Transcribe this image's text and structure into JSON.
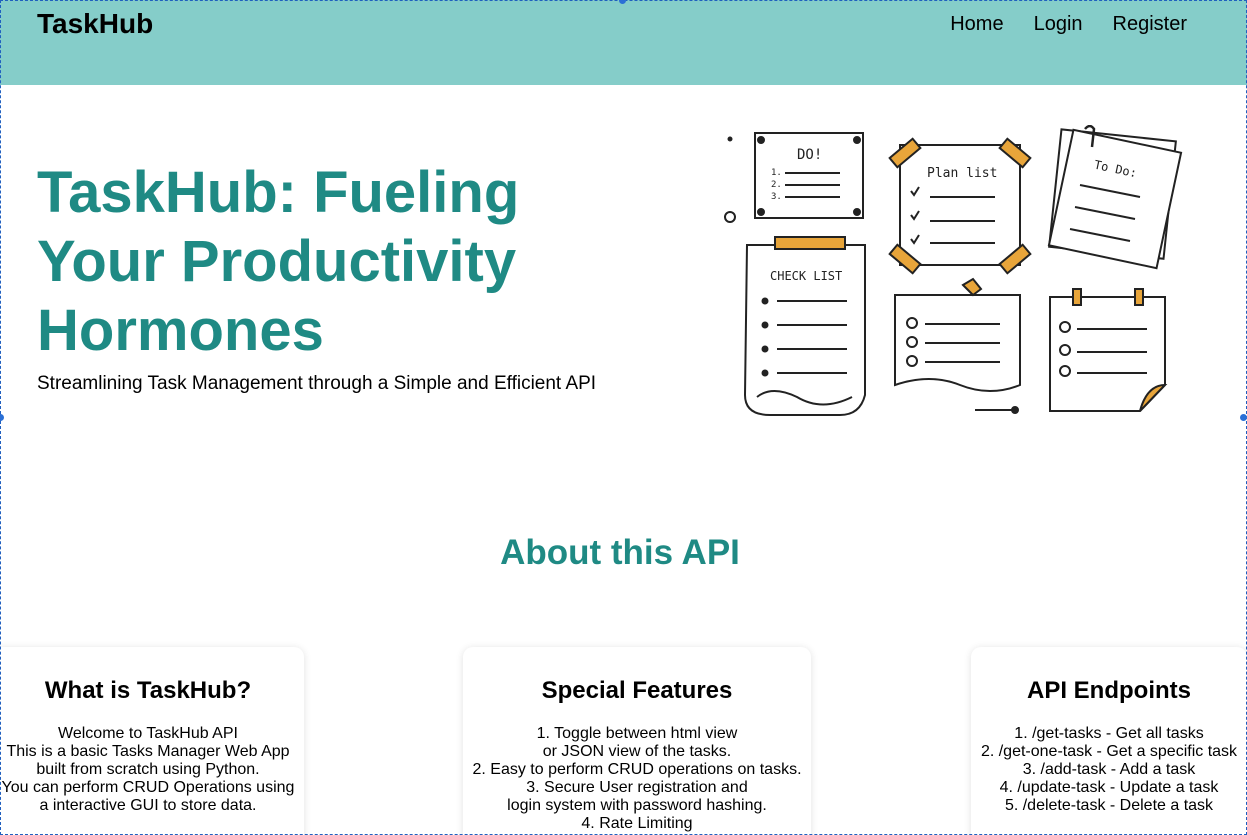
{
  "navbar": {
    "brand": "TaskHub",
    "links": [
      "Home",
      "Login",
      "Register"
    ]
  },
  "hero": {
    "title_lines": [
      "TaskHub: Fueling",
      "Your Productivity",
      "Hormones"
    ],
    "subtitle": "Streamlining Task Management through a Simple and Efficient API"
  },
  "illustration": {
    "note_do": "DO!",
    "note_plan": "Plan list",
    "note_todo": "To Do:",
    "note_check": "CHECK LIST",
    "numbers": [
      "1.",
      "2.",
      "3."
    ]
  },
  "about": {
    "title": "About this API",
    "cards": [
      {
        "title": "What is TaskHub?",
        "lines": [
          "Welcome to TaskHub API",
          "This is a basic Tasks Manager Web App",
          "built from scratch using Python.",
          "You can perform CRUD Operations using",
          "a interactive GUI to store data."
        ]
      },
      {
        "title": "Special Features",
        "lines": [
          "1. Toggle between html view",
          "or JSON view of the tasks.",
          "2. Easy to perform CRUD operations on tasks.",
          "3. Secure User registration and",
          "login system with password hashing.",
          "4. Rate Limiting"
        ]
      },
      {
        "title": "API Endpoints",
        "lines": [
          "1. /get-tasks - Get all tasks",
          "2. /get-one-task - Get a specific task",
          "3. /add-task - Add a task",
          "4. /update-task - Update a task",
          "5. /delete-task - Delete a task"
        ]
      }
    ]
  },
  "colors": {
    "navbar_bg": "#85cdc9",
    "accent_teal": "#1f8a84",
    "tape": "#e8a53a",
    "selection_handle": "#2a6fd6"
  }
}
